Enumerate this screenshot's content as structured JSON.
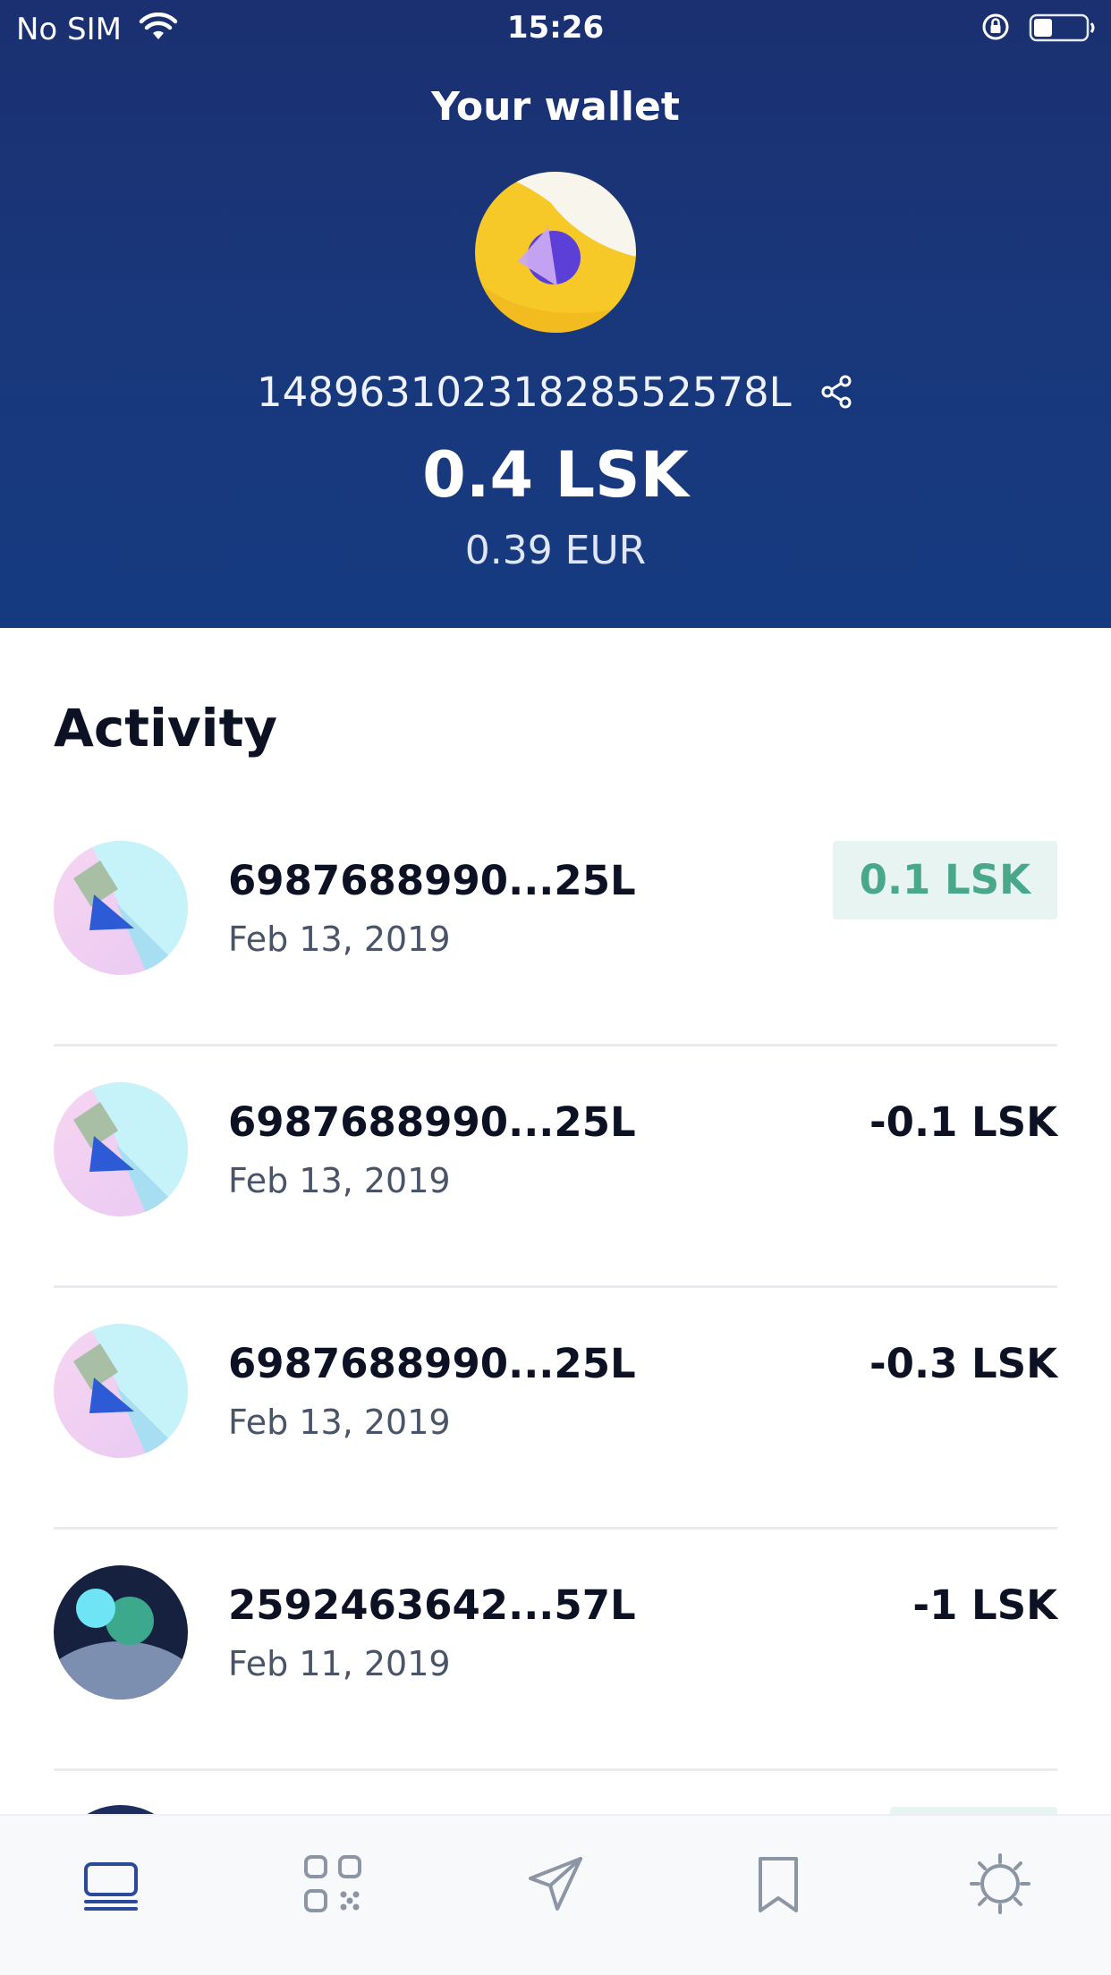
{
  "status_bar": {
    "carrier": "No SIM",
    "time": "15:26",
    "battery_level": 0.35
  },
  "header": {
    "title": "Your wallet",
    "address": "14896310231828552578L",
    "balance": "0.4 LSK",
    "fiat_balance": "0.39 EUR"
  },
  "activity": {
    "title": "Activity",
    "transactions": [
      {
        "address": "6987688990...25L",
        "date": "Feb 13, 2019",
        "amount": "0.1 LSK",
        "incoming": true
      },
      {
        "address": "6987688990...25L",
        "date": "Feb 13, 2019",
        "amount": "-0.1 LSK",
        "incoming": false
      },
      {
        "address": "6987688990...25L",
        "date": "Feb 13, 2019",
        "amount": "-0.3 LSK",
        "incoming": false
      },
      {
        "address": "2592463642...57L",
        "date": "Feb 11, 2019",
        "amount": "-1 LSK",
        "incoming": false
      }
    ]
  },
  "tabbar": {
    "tabs": [
      {
        "icon": "wallet-icon",
        "active": true
      },
      {
        "icon": "qr-code-icon",
        "active": false
      },
      {
        "icon": "send-icon",
        "active": false
      },
      {
        "icon": "bookmark-icon",
        "active": false
      },
      {
        "icon": "settings-gear-icon",
        "active": false
      }
    ]
  },
  "colors": {
    "header_bg": "#1a3070",
    "incoming_amount": "#4aa88a",
    "incoming_badge_bg": "#e7f4f1",
    "active_tab": "#2c4a9c",
    "inactive_tab": "#8c95a3"
  }
}
